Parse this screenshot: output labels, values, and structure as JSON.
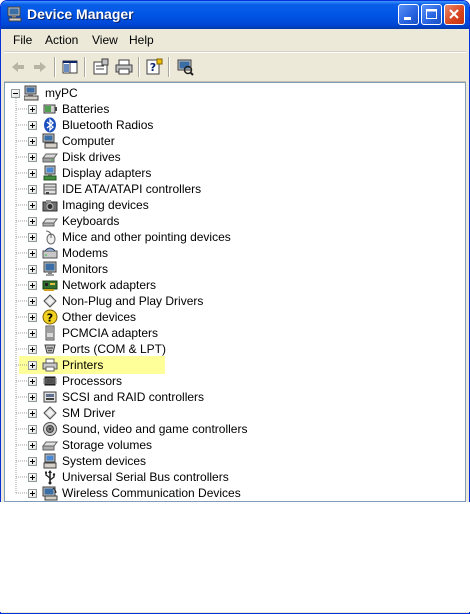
{
  "window": {
    "title": "Device Manager"
  },
  "menu": {
    "items": [
      "File",
      "Action",
      "View",
      "Help"
    ]
  },
  "toolbar": {
    "buttons": [
      "back-icon",
      "forward-icon",
      "show-hide-console-tree-icon",
      "properties-icon",
      "print-icon",
      "help-icon",
      "scan-hardware-icon"
    ]
  },
  "tree": {
    "root": "myPC",
    "items": [
      {
        "label": "Batteries",
        "icon": "battery-icon"
      },
      {
        "label": "Bluetooth Radios",
        "icon": "bluetooth-icon"
      },
      {
        "label": "Computer",
        "icon": "computer-icon"
      },
      {
        "label": "Disk drives",
        "icon": "disk-drive-icon"
      },
      {
        "label": "Display adapters",
        "icon": "display-adapter-icon"
      },
      {
        "label": "IDE ATA/ATAPI controllers",
        "icon": "ide-controller-icon"
      },
      {
        "label": "Imaging devices",
        "icon": "camera-icon"
      },
      {
        "label": "Keyboards",
        "icon": "keyboard-icon"
      },
      {
        "label": "Mice and other pointing devices",
        "icon": "mouse-icon"
      },
      {
        "label": "Modems",
        "icon": "modem-icon"
      },
      {
        "label": "Monitors",
        "icon": "monitor-icon"
      },
      {
        "label": "Network adapters",
        "icon": "network-adapter-icon"
      },
      {
        "label": "Non-Plug and Play Drivers",
        "icon": "driver-icon"
      },
      {
        "label": "Other devices",
        "icon": "unknown-device-icon"
      },
      {
        "label": "PCMCIA adapters",
        "icon": "pcmcia-icon"
      },
      {
        "label": "Ports (COM & LPT)",
        "icon": "port-icon"
      },
      {
        "label": "Printers",
        "icon": "printer-icon"
      },
      {
        "label": "Processors",
        "icon": "processor-icon"
      },
      {
        "label": "SCSI and RAID controllers",
        "icon": "scsi-icon"
      },
      {
        "label": "SM Driver",
        "icon": "driver-icon"
      },
      {
        "label": "Sound, video and game controllers",
        "icon": "sound-icon"
      },
      {
        "label": "Storage volumes",
        "icon": "storage-volume-icon"
      },
      {
        "label": "System devices",
        "icon": "system-device-icon"
      },
      {
        "label": "Universal Serial Bus controllers",
        "icon": "usb-icon"
      },
      {
        "label": "Wireless Communication Devices",
        "icon": "wireless-icon"
      }
    ],
    "highlighted_item": "Printers",
    "highlight_color": "#ffff99"
  },
  "colors": {
    "title_bar": "#0055e5",
    "window_face": "#ece9d8",
    "tree_border": "#7f9db9"
  }
}
